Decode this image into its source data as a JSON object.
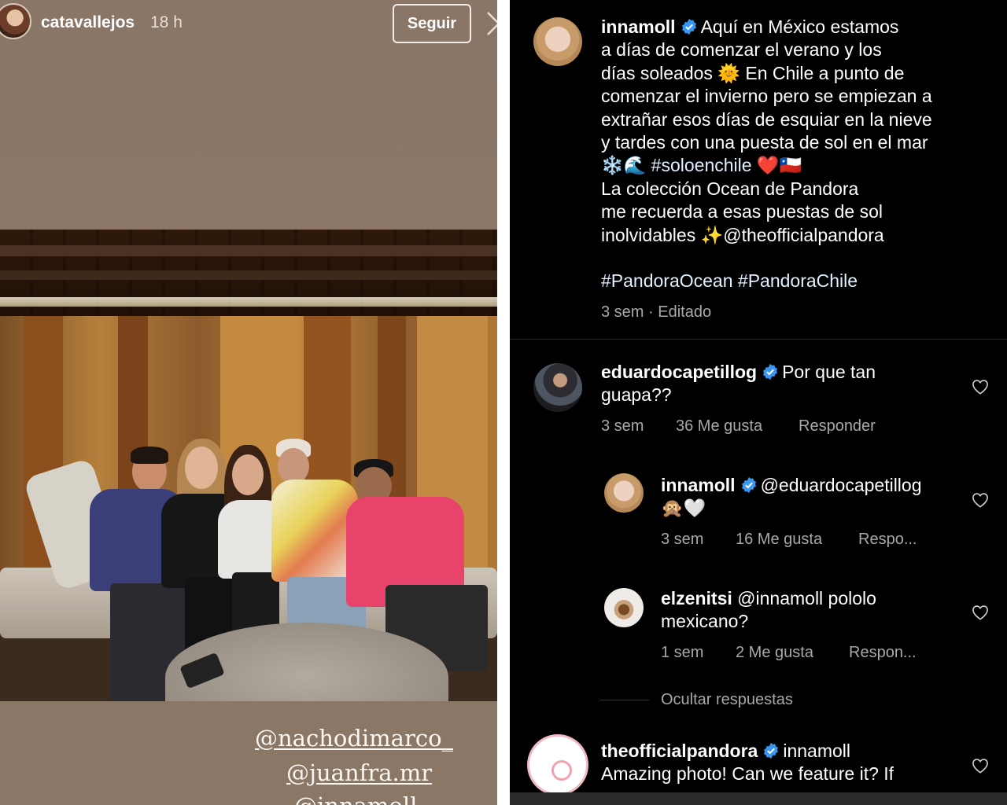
{
  "story": {
    "username": "catavallejos",
    "time": "18 h",
    "follow_label": "Seguir",
    "mentions": [
      "@nachodimarco_",
      "@juanfra.mr",
      "@innamoll"
    ]
  },
  "post": {
    "username": "innamoll",
    "caption_lines": [
      "Aquí en México estamos",
      "a días de comenzar el verano y los",
      "días soleados 🌞 En Chile a punto de",
      "comenzar el invierno pero se empiezan a",
      "extrañar esos días de esquiar en la nieve",
      "y tardes  con una puesta de sol en el mar",
      "❄️🌊 #soloenchile ❤️🇨🇱",
      "La colección Ocean de Pandora",
      "me recuerda a esas puestas de sol",
      "inolvidables ✨@theofficialpandora",
      "",
      "#PandoraOcean #PandoraChile"
    ],
    "meta": "3 sem · Editado"
  },
  "comments": [
    {
      "username": "eduardocapetillog",
      "text_line1": "Por que tan",
      "text_line2": "guapa??",
      "time": "3 sem",
      "likes": "36 Me gusta",
      "reply": "Responder"
    },
    {
      "username": "innamoll",
      "text_line1": "@eduardocapetillog",
      "text_line2": "🙊🤍",
      "time": "3 sem",
      "likes": "16 Me gusta",
      "reply": "Respo..."
    },
    {
      "username": "elzenitsi",
      "text_line1": "@innamoll pololo",
      "text_line2": "mexicano?",
      "time": "1 sem",
      "likes": "2 Me gusta",
      "reply": "Respon..."
    },
    {
      "username": "theofficialpandora",
      "text_line1": "innamoll",
      "text_line2": "Amazing photo! Can we feature it? If"
    }
  ],
  "hide_replies": "Ocultar respuestas",
  "colors": {
    "verified": "#3897f0",
    "meta": "#a8a8a8",
    "story_bg": "#8a7564"
  }
}
